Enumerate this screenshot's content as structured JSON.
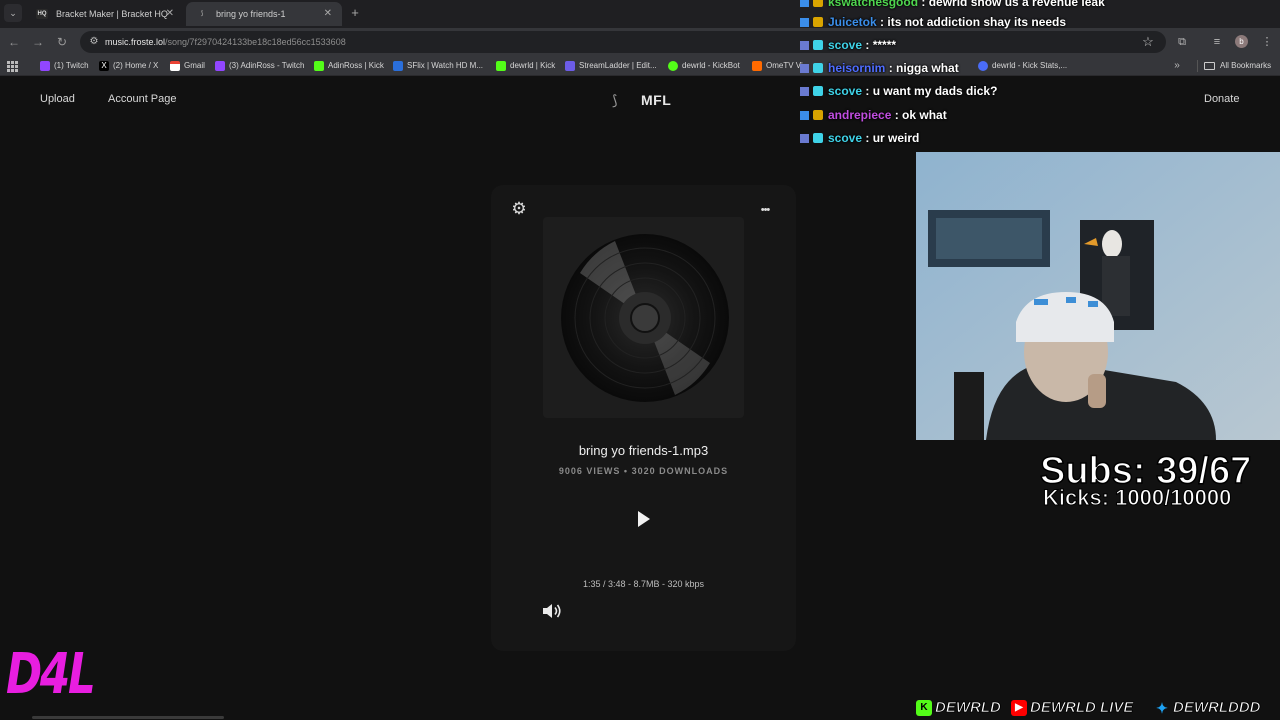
{
  "browser": {
    "tabs": [
      {
        "title": "Bracket Maker | Bracket HQ",
        "favicon": "HQ"
      },
      {
        "title": "bring yo friends-1",
        "favicon": ""
      }
    ],
    "url_host": "music.froste.lol",
    "url_path": "/song/7f2970424133be18c18ed56cc1533608",
    "bookmarks": [
      "(1) Twitch",
      "(2) Home / X",
      "Gmail",
      "(3) AdinRoss - Twitch",
      "AdinRoss | Kick",
      "SFlix | Watch HD M...",
      "dewrld | Kick",
      "StreamLadder | Edit...",
      "dewrld - KickBot",
      "OmeTV Vi...",
      "dewrld - Kick Stats,..."
    ],
    "all_bookmarks": "All Bookmarks",
    "avatar_letter": "b"
  },
  "site": {
    "nav_upload": "Upload",
    "nav_account": "Account Page",
    "brand": "MFL",
    "nav_donate": "Donate"
  },
  "player": {
    "title": "bring yo friends-1.mp3",
    "stats": "9006 VIEWS • 3020 DOWNLOADS",
    "timeinfo": "1:35 / 3:48 - 8.7MB - 320 kbps",
    "progress": 0.417
  },
  "overlay": {
    "chat": [
      {
        "user": "kswatchesgood",
        "text": "dewrld show us a revenue leak",
        "color": "#4fd64f"
      },
      {
        "user": "Juicetok",
        "text": "its not addiction shay its needs",
        "color": "#3b8eea"
      },
      {
        "user": "scove",
        "text": "*****",
        "color": "#3fd3e8"
      },
      {
        "user": "heisornim",
        "text": "nigga what",
        "color": "#4f6dff"
      },
      {
        "user": "scove",
        "text": "u want my dads dick?",
        "color": "#3fd3e8"
      },
      {
        "user": "andrepiece",
        "text": "ok what",
        "color": "#c04de0"
      },
      {
        "user": "scove",
        "text": "ur weird",
        "color": "#3fd3e8"
      }
    ],
    "subs": "Subs: 39/67",
    "kicks": "Kicks: 1000/10000",
    "logo": "D4L",
    "socials": [
      {
        "label": "DEWRLD",
        "icon": "kick-icon",
        "color": "#53fc18"
      },
      {
        "label": "DEWRLD LIVE",
        "icon": "youtube-icon",
        "color": "#ff0000"
      },
      {
        "label": "DEWRLDDD",
        "icon": "twitter-icon",
        "color": "#1da1f2"
      }
    ]
  }
}
